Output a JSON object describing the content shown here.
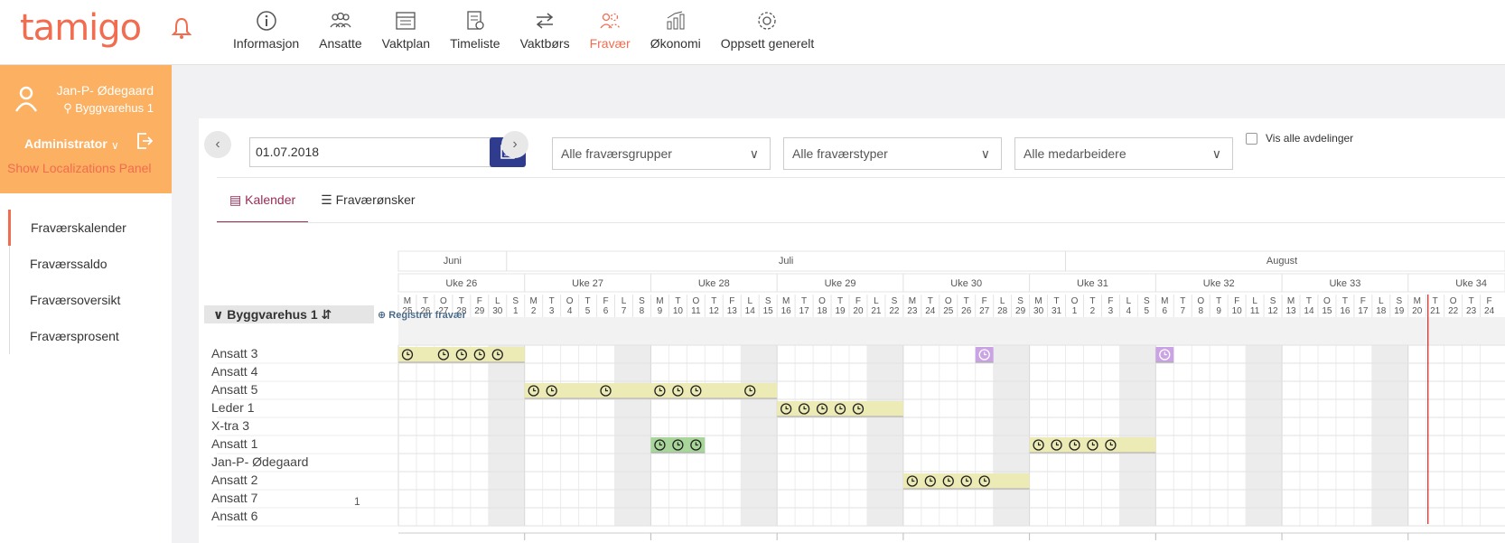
{
  "app": {
    "logo": "tamigo"
  },
  "nav": {
    "items": [
      {
        "label": "Informasjon",
        "icon": "info-icon"
      },
      {
        "label": "Ansatte",
        "icon": "people-icon"
      },
      {
        "label": "Vaktplan",
        "icon": "schedule-icon"
      },
      {
        "label": "Timeliste",
        "icon": "timesheet-icon"
      },
      {
        "label": "Vaktbørs",
        "icon": "swap-icon"
      },
      {
        "label": "Fravær",
        "icon": "absence-icon",
        "active": true
      },
      {
        "label": "Økonomi",
        "icon": "economy-icon"
      },
      {
        "label": "Oppsett generelt",
        "icon": "gear-icon"
      }
    ]
  },
  "user": {
    "name": "Jan-P- Ødegaard",
    "department": "Byggvarehus 1",
    "role": "Administrator",
    "localizations_link": "Show Localizations Panel"
  },
  "sidebar": {
    "items": [
      {
        "label": "Fraværskalender",
        "active": true
      },
      {
        "label": "Fraværssaldo"
      },
      {
        "label": "Fraværsoversikt"
      },
      {
        "label": "Fraværsprosent"
      }
    ]
  },
  "filters": {
    "date": "01.07.2018",
    "groups": "Alle fraværsgrupper",
    "types": "Alle fraværstyper",
    "employees": "Alle medarbeidere",
    "show_all_departments": "Vis alle avdelinger"
  },
  "tabs": [
    {
      "label": "Kalender",
      "active": true
    },
    {
      "label": "Fraværønsker"
    }
  ],
  "calendar": {
    "months": [
      {
        "label": "Juni",
        "start": 0,
        "span": 6
      },
      {
        "label": "Juli",
        "start": 6,
        "span": 31
      },
      {
        "label": "August",
        "start": 37,
        "span": 24
      }
    ],
    "weeks": [
      "Uke 26",
      "Uke 27",
      "Uke 28",
      "Uke 29",
      "Uke 30",
      "Uke 31",
      "Uke 32",
      "Uke 33",
      "Uke 34"
    ],
    "weekdays": [
      "M",
      "T",
      "O",
      "T",
      "F",
      "L",
      "S"
    ],
    "days": [
      25,
      26,
      27,
      28,
      29,
      30,
      1,
      2,
      3,
      4,
      5,
      6,
      7,
      8,
      9,
      10,
      11,
      12,
      13,
      14,
      15,
      16,
      17,
      18,
      19,
      20,
      21,
      22,
      23,
      24,
      25,
      26,
      27,
      28,
      29,
      30,
      31,
      1,
      2,
      3,
      4,
      5,
      6,
      7,
      8,
      9,
      10,
      11,
      12,
      13,
      14,
      15,
      16,
      17,
      18,
      19,
      20,
      21,
      22,
      23,
      24
    ],
    "today_index": 57,
    "group": "Byggvarehus 1",
    "register_link": "Registrer fravær",
    "employees": [
      "Ansatt 3",
      "Ansatt 4",
      "Ansatt 5",
      "Leder 1",
      "X-tra 3",
      "Ansatt 1",
      "Jan-P- Ødegaard",
      "Ansatt 2",
      "Ansatt 7",
      "Ansatt 6"
    ],
    "absences": [
      {
        "row": 0,
        "start": 0,
        "end": 7,
        "color": "#ecebb5",
        "clocks": [
          0,
          2,
          3,
          4,
          5
        ]
      },
      {
        "row": 0,
        "start": 32,
        "end": 33,
        "color": "#c9a3e3",
        "clocks": [
          32
        ],
        "clock_style": "light"
      },
      {
        "row": 0,
        "start": 42,
        "end": 43,
        "color": "#c9a3e3",
        "clocks": [
          42
        ],
        "clock_style": "light"
      },
      {
        "row": 2,
        "start": 7,
        "end": 21,
        "color": "#ecebb5",
        "clocks": [
          7,
          8,
          11,
          14,
          15,
          16,
          19
        ]
      },
      {
        "row": 3,
        "start": 21,
        "end": 28,
        "color": "#ecebb5",
        "clocks": [
          21,
          22,
          23,
          24,
          25
        ]
      },
      {
        "row": 5,
        "start": 14,
        "end": 17,
        "color": "#a8d59a",
        "clocks": [
          14,
          15,
          16
        ]
      },
      {
        "row": 5,
        "start": 35,
        "end": 42,
        "color": "#ecebb5",
        "clocks": [
          35,
          36,
          37,
          38,
          39
        ]
      },
      {
        "row": 7,
        "start": 28,
        "end": 35,
        "color": "#ecebb5",
        "clocks": [
          28,
          29,
          30,
          31,
          32
        ]
      }
    ],
    "page": "1"
  }
}
